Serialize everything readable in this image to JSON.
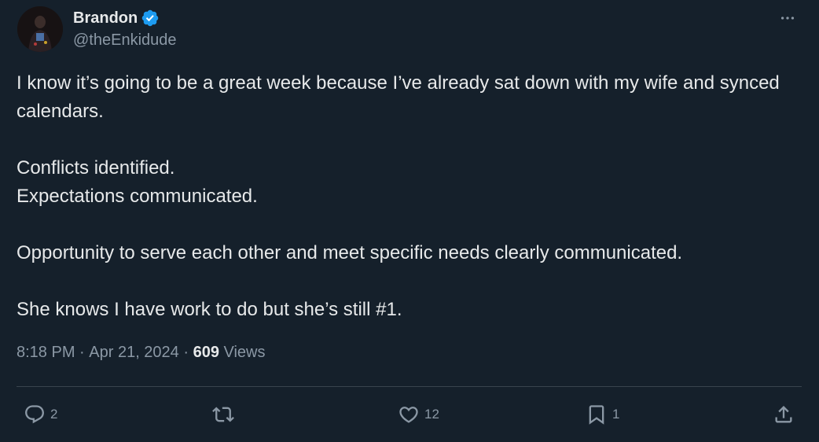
{
  "author": {
    "display_name": "Brandon",
    "handle": "@theEnkidude",
    "verified": true
  },
  "tweet": {
    "paragraphs": [
      "I know it’s going to be a great week because I’ve already sat down with my wife and synced calendars.",
      "Conflicts identified.\nExpectations communicated.",
      "Opportunity to serve each other and meet specific needs clearly communicated.",
      "She knows I have work to do but she’s still #1."
    ],
    "time": "8:18 PM",
    "separator": " · ",
    "date": "Apr 21, 2024",
    "views_count": "609",
    "views_label": " Views"
  },
  "actions": {
    "replies": "2",
    "retweets": "",
    "likes": "12",
    "bookmarks": "1"
  },
  "colors": {
    "background": "#15202b",
    "text_primary": "#e7e9ea",
    "text_secondary": "#8b98a5",
    "divider": "#38444d",
    "verified_blue": "#1d9bf0"
  },
  "icons": {
    "verified": "verified-badge-icon",
    "more": "more-dots-icon",
    "reply": "reply-icon",
    "retweet": "retweet-icon",
    "like": "heart-icon",
    "bookmark": "bookmark-icon",
    "share": "share-icon"
  }
}
